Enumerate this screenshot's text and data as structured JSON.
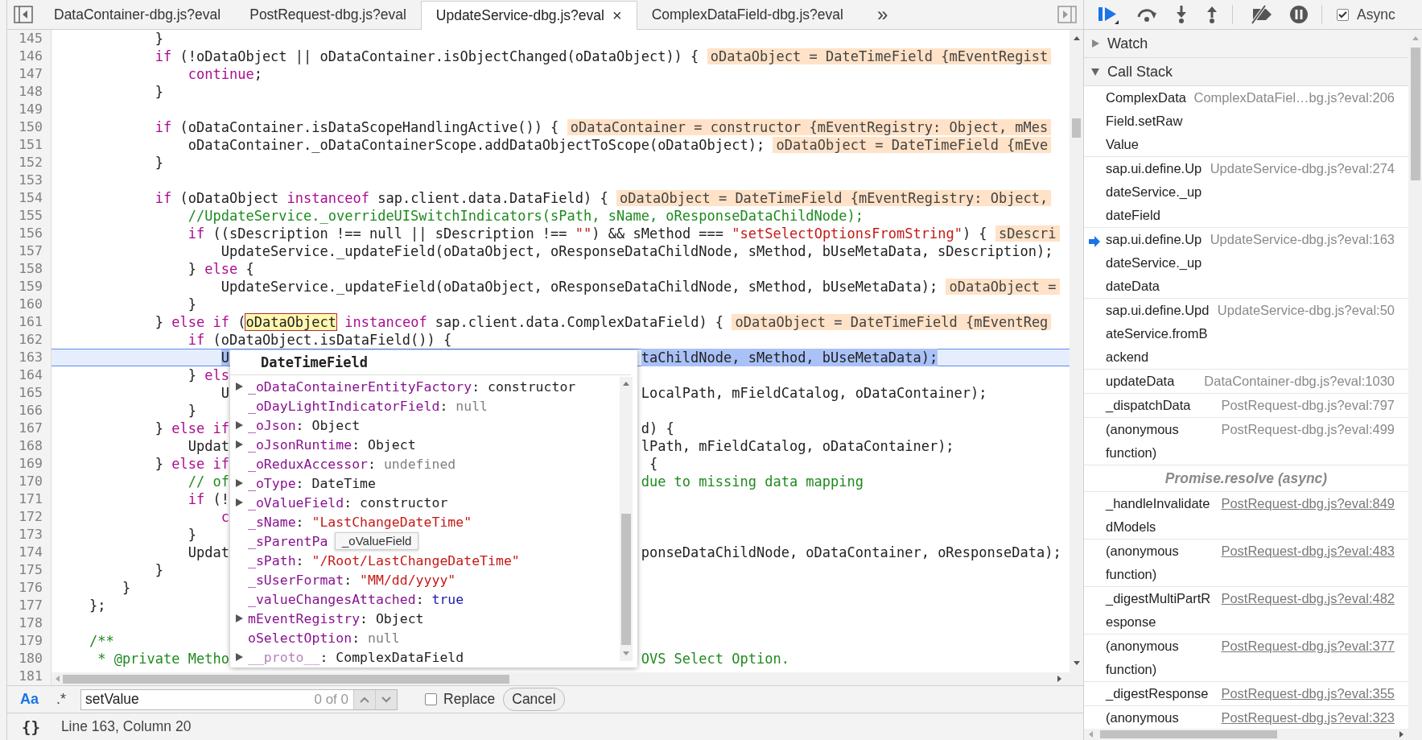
{
  "tabs": [
    {
      "label": "DataContainer-dbg.js?eval",
      "selected": false
    },
    {
      "label": "PostRequest-dbg.js?eval",
      "selected": false
    },
    {
      "label": "UpdateService-dbg.js?eval",
      "selected": true,
      "close": "×"
    },
    {
      "label": "ComplexDataField-dbg.js?eval",
      "selected": false
    }
  ],
  "tab_overflow": "»",
  "editor": {
    "lines": [
      {
        "number": "145",
        "code": [
          {
            "kind": "plain",
            "text": "            }"
          }
        ],
        "current": false
      },
      {
        "number": "146",
        "code": [
          {
            "kind": "keyword",
            "text": "            if"
          },
          {
            "kind": "plain",
            "text": " (!oDataObject || oDataContainer.isObjectChanged(oDataObject)) {"
          }
        ],
        "inline_value": "oDataObject = DateTimeField {mEventRegist",
        "current": false
      },
      {
        "number": "147",
        "code": [
          {
            "kind": "keyword",
            "text": "                continue"
          },
          {
            "kind": "plain",
            "text": ";"
          }
        ],
        "current": false
      },
      {
        "number": "148",
        "code": [
          {
            "kind": "plain",
            "text": "            }"
          }
        ],
        "current": false
      },
      {
        "number": "149",
        "current": false
      },
      {
        "number": "150",
        "code": [
          {
            "kind": "keyword",
            "text": "            if"
          },
          {
            "kind": "plain",
            "text": " (oDataContainer.isDataScopeHandlingActive()) {"
          }
        ],
        "inline_value": "oDataContainer = constructor {mEventRegistry: Object, mMes",
        "current": false
      },
      {
        "number": "151",
        "code": [
          {
            "kind": "plain",
            "text": "                oDataContainer._oDataContainerScope.addDataObjectToScope(oDataObject);"
          }
        ],
        "inline_value": "oDataObject = DateTimeField {mEve",
        "current": false
      },
      {
        "number": "152",
        "code": [
          {
            "kind": "plain",
            "text": "            }"
          }
        ],
        "current": false
      },
      {
        "number": "153",
        "current": false
      },
      {
        "number": "154",
        "code": [
          {
            "kind": "keyword",
            "text": "            if"
          },
          {
            "kind": "plain",
            "text": " (oDataObject "
          },
          {
            "kind": "keyword",
            "text": "instanceof"
          },
          {
            "kind": "plain",
            "text": " sap.client.data.DataField) {"
          }
        ],
        "inline_value": "oDataObject = DateTimeField {mEventRegistry: Object,",
        "current": false
      },
      {
        "number": "155",
        "code": [
          {
            "kind": "comment",
            "text": "                //UpdateService._overrideUISwitchIndicators(sPath, sName, oResponseDataChildNode);"
          }
        ],
        "current": false
      },
      {
        "number": "156",
        "code": [
          {
            "kind": "keyword",
            "text": "                if"
          },
          {
            "kind": "plain",
            "text": " ((sDescription !== null || sDescription !== "
          },
          {
            "kind": "string",
            "text": "\"\""
          },
          {
            "kind": "plain",
            "text": ") && sMethod === "
          },
          {
            "kind": "string",
            "text": "\"setSelectOptionsFromString\""
          },
          {
            "kind": "plain",
            "text": ") {"
          }
        ],
        "inline_value": "sDescri",
        "current": false
      },
      {
        "number": "157",
        "code": [
          {
            "kind": "plain",
            "text": "                    UpdateService._updateField(oDataObject, oResponseDataChildNode, sMethod, bUseMetaData, sDescription);"
          }
        ],
        "current": false
      },
      {
        "number": "158",
        "code": [
          {
            "kind": "plain",
            "text": "                } "
          },
          {
            "kind": "keyword",
            "text": "else"
          },
          {
            "kind": "plain",
            "text": " {"
          }
        ],
        "current": false
      },
      {
        "number": "159",
        "code": [
          {
            "kind": "plain",
            "text": "                    UpdateService._updateField(oDataObject, oResponseDataChildNode, sMethod, bUseMetaData);"
          }
        ],
        "inline_value": "oDataObject =",
        "current": false
      },
      {
        "number": "160",
        "code": [
          {
            "kind": "plain",
            "text": "                }"
          }
        ],
        "current": false
      },
      {
        "number": "161",
        "code": [
          {
            "kind": "plain",
            "text": "            } "
          },
          {
            "kind": "keyword",
            "text": "else if"
          },
          {
            "kind": "plain",
            "text": " ("
          },
          {
            "kind": "hover",
            "text": "oDataObject"
          },
          {
            "kind": "keyword",
            "text": " instanceof"
          },
          {
            "kind": "plain",
            "text": " sap.client.data.ComplexDataField) {"
          }
        ],
        "inline_value": "oDataObject = DateTimeField {mEventReg",
        "current": false
      },
      {
        "number": "162",
        "code": [
          {
            "kind": "keyword",
            "text": "                if"
          },
          {
            "kind": "plain",
            "text": " (oDataObject.isDataField()) {"
          }
        ],
        "current": false
      },
      {
        "number": "163",
        "left": [
          {
            "kind": "plain",
            "text": "                    U"
          }
        ],
        "right": [
          {
            "kind": "plain",
            "text": "taChildNode, sMethod, bUseMetaData);"
          }
        ],
        "current": true
      },
      {
        "number": "164",
        "left": [
          {
            "kind": "plain",
            "text": "                } "
          },
          {
            "kind": "keyword",
            "text": "els"
          }
        ],
        "current": false
      },
      {
        "number": "165",
        "left": [
          {
            "kind": "plain",
            "text": "                    U"
          }
        ],
        "right": [
          {
            "kind": "plain",
            "text": "LocalPath, mFieldCatalog, oDataContainer);"
          }
        ],
        "current": false
      },
      {
        "number": "166",
        "code": [
          {
            "kind": "plain",
            "text": "                }"
          }
        ],
        "current": false
      },
      {
        "number": "167",
        "left": [
          {
            "kind": "plain",
            "text": "            } "
          },
          {
            "kind": "keyword",
            "text": "else if"
          }
        ],
        "right": [
          {
            "kind": "plain",
            "text": "d) {"
          }
        ],
        "current": false
      },
      {
        "number": "168",
        "left": [
          {
            "kind": "plain",
            "text": "                Updat"
          }
        ],
        "right": [
          {
            "kind": "plain",
            "text": "lPath, mFieldCatalog, oDataContainer);"
          }
        ],
        "current": false
      },
      {
        "number": "169",
        "left": [
          {
            "kind": "plain",
            "text": "            } "
          },
          {
            "kind": "keyword",
            "text": "else if"
          }
        ],
        "right": [
          {
            "kind": "plain",
            "text": " {"
          }
        ],
        "current": false
      },
      {
        "number": "170",
        "left": [
          {
            "kind": "comment",
            "text": "                // of"
          }
        ],
        "right": [
          {
            "kind": "comment",
            "text": "due to missing data mapping"
          }
        ],
        "current": false
      },
      {
        "number": "171",
        "left": [
          {
            "kind": "keyword",
            "text": "                if"
          },
          {
            "kind": "plain",
            "text": " (!"
          }
        ],
        "current": false
      },
      {
        "number": "172",
        "left": [
          {
            "kind": "keyword",
            "text": "                    c"
          }
        ],
        "current": false
      },
      {
        "number": "173",
        "code": [
          {
            "kind": "plain",
            "text": "                }"
          }
        ],
        "current": false
      },
      {
        "number": "174",
        "left": [
          {
            "kind": "plain",
            "text": "                Updat"
          }
        ],
        "right": [
          {
            "kind": "plain",
            "text": "ponseDataChildNode, oDataContainer, oResponseData);"
          }
        ],
        "current": false
      },
      {
        "number": "175",
        "code": [
          {
            "kind": "plain",
            "text": "            }"
          }
        ],
        "current": false
      },
      {
        "number": "176",
        "code": [
          {
            "kind": "plain",
            "text": "        }"
          }
        ],
        "current": false
      },
      {
        "number": "177",
        "code": [
          {
            "kind": "plain",
            "text": "    };"
          }
        ],
        "current": false
      },
      {
        "number": "178",
        "current": false
      },
      {
        "number": "179",
        "code": [
          {
            "kind": "comment",
            "text": "    /**"
          }
        ],
        "current": false
      },
      {
        "number": "180",
        "left": [
          {
            "kind": "comment",
            "text": "     * @private Metho"
          }
        ],
        "right": [
          {
            "kind": "comment",
            "text": "OVS Select Option."
          }
        ],
        "current": false
      },
      {
        "number": "181",
        "current": false
      }
    ]
  },
  "popup": {
    "title": "DateTimeField",
    "tooltip": "_oValueField",
    "properties": [
      {
        "name": "_oDataContainerEntityFactory",
        "colon": ":",
        "value": "constructor",
        "kind": "object",
        "expandable": true,
        "dimmed": false
      },
      {
        "name": "_oDayLightIndicatorField",
        "colon": ":",
        "value": "null",
        "kind": "null",
        "expandable": false,
        "dimmed": false
      },
      {
        "name": "_oJson",
        "colon": ":",
        "value": "Object",
        "kind": "object",
        "expandable": true,
        "dimmed": false
      },
      {
        "name": "_oJsonRuntime",
        "colon": ":",
        "value": "Object",
        "kind": "object",
        "expandable": true,
        "dimmed": false
      },
      {
        "name": "_oReduxAccessor",
        "colon": ":",
        "value": "undefined",
        "kind": "null",
        "expandable": false,
        "dimmed": false
      },
      {
        "name": "_oType",
        "colon": ":",
        "value": "DateTime",
        "kind": "object",
        "expandable": true,
        "dimmed": false
      },
      {
        "name": "_oValueField",
        "colon": ":",
        "value": "constructor",
        "kind": "object",
        "expandable": true,
        "dimmed": false
      },
      {
        "name": "_sName",
        "colon": ":",
        "value": "\"LastChangeDateTime\"",
        "kind": "string",
        "expandable": false,
        "dimmed": false
      },
      {
        "name": "_sParentPa",
        "expandable": false,
        "dimmed": false
      },
      {
        "name": "_sPath",
        "colon": ":",
        "value": "\"/Root/LastChangeDateTime\"",
        "kind": "string",
        "expandable": false,
        "dimmed": false
      },
      {
        "name": "_sUserFormat",
        "colon": ":",
        "value": "\"MM/dd/yyyy\"",
        "kind": "string",
        "expandable": false,
        "dimmed": false
      },
      {
        "name": "_valueChangesAttached",
        "colon": ":",
        "value": "true",
        "kind": "boolean",
        "expandable": false,
        "dimmed": false
      },
      {
        "name": "mEventRegistry",
        "colon": ":",
        "value": "Object",
        "kind": "object",
        "expandable": true,
        "dimmed": false
      },
      {
        "name": "oSelectOption",
        "colon": ":",
        "value": "null",
        "kind": "null",
        "expandable": false,
        "dimmed": false
      },
      {
        "name": "__proto__",
        "colon": ":",
        "value": "ComplexDataField",
        "kind": "object",
        "expandable": true,
        "dimmed": true
      }
    ]
  },
  "search": {
    "case_toggle": {
      "label": "Aa",
      "selected": true
    },
    "regex_toggle": {
      "label": ".*",
      "selected": false
    },
    "value": "setValue",
    "match_count": "0 of 0",
    "replace": {
      "label": "Replace",
      "checked": false
    },
    "cancel": "Cancel"
  },
  "status_bar": {
    "format_button": "{}",
    "position": "Line 163, Column 20"
  },
  "debugger": {
    "async": {
      "label": "Async",
      "checked": true
    },
    "sections": [
      {
        "title": "Watch",
        "expanded": false
      },
      {
        "title": "Call Stack",
        "expanded": true
      }
    ],
    "call_stack": [
      {
        "kind": "frame",
        "function": "ComplexDataField.setRawValue",
        "location": "ComplexDataFiel…bg.js?eval:206",
        "current": false,
        "underlined": false
      },
      {
        "kind": "frame",
        "function": "sap.ui.define.UpdateService._updateField",
        "location": "UpdateService-dbg.js?eval:274",
        "current": false,
        "underlined": false
      },
      {
        "kind": "frame",
        "function": "sap.ui.define.UpdateService._updateData",
        "location": "UpdateService-dbg.js?eval:163",
        "current": true,
        "underlined": false
      },
      {
        "kind": "frame",
        "function": "sap.ui.define.UpdateService.fromBackend",
        "location": "UpdateService-dbg.js?eval:50",
        "current": false,
        "underlined": false
      },
      {
        "kind": "frame",
        "function": "updateData",
        "location": "DataContainer-dbg.js?eval:1030",
        "current": false,
        "underlined": false
      },
      {
        "kind": "frame",
        "function": "_dispatchData",
        "location": "PostRequest-dbg.js?eval:797",
        "current": false,
        "underlined": false
      },
      {
        "kind": "frame",
        "function": "(anonymous function)",
        "location": "PostRequest-dbg.js?eval:499",
        "current": false,
        "underlined": false
      },
      {
        "kind": "async",
        "label": "Promise.resolve (async)"
      },
      {
        "kind": "frame",
        "function": "_handleInvalidatedModels",
        "location": "PostRequest-dbg.js?eval:849",
        "current": false,
        "underlined": true
      },
      {
        "kind": "frame",
        "function": "(anonymous function)",
        "location": "PostRequest-dbg.js?eval:483",
        "current": false,
        "underlined": true
      },
      {
        "kind": "frame",
        "function": "_digestMultiPartResponse",
        "location": "PostRequest-dbg.js?eval:482",
        "current": false,
        "underlined": true
      },
      {
        "kind": "frame",
        "function": "(anonymous function)",
        "location": "PostRequest-dbg.js?eval:377",
        "current": false,
        "underlined": true
      },
      {
        "kind": "frame",
        "function": "_digestResponse",
        "location": "PostRequest-dbg.js?eval:355",
        "current": false,
        "underlined": true
      },
      {
        "kind": "frame",
        "function": "(anonymous",
        "location": "PostRequest-dbg.js?eval:323",
        "current": false,
        "underlined": true
      }
    ]
  }
}
